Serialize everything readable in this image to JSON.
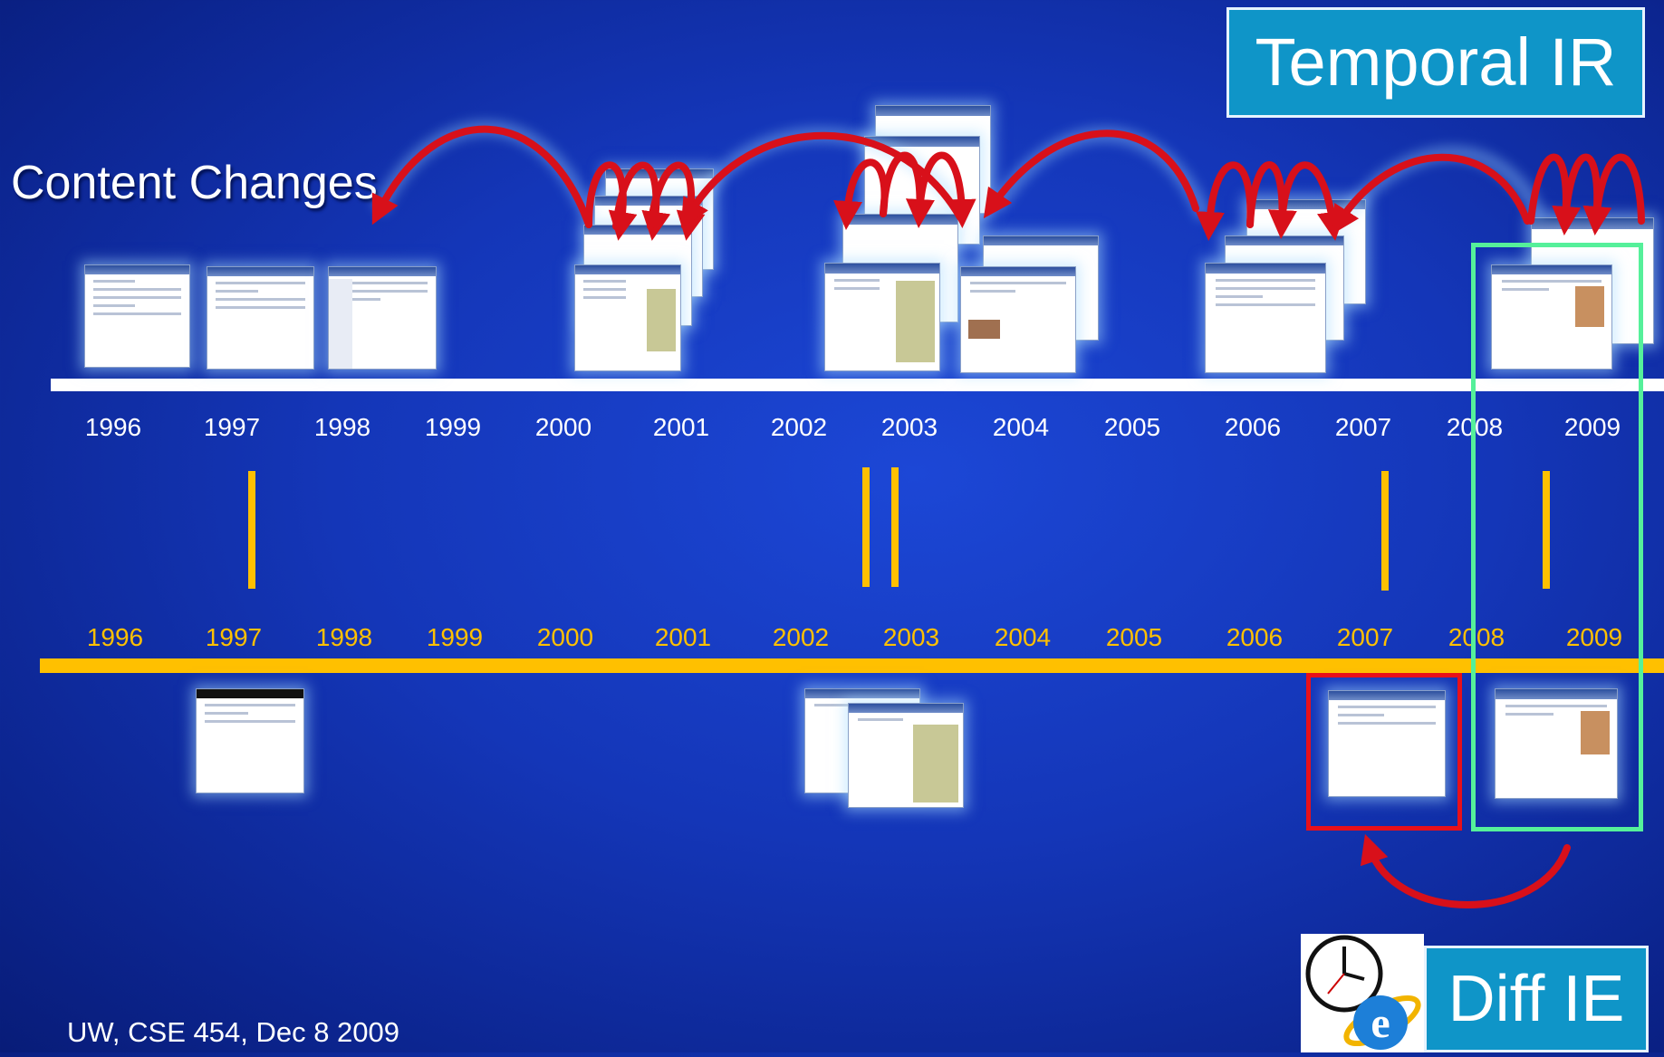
{
  "title": "Temporal IR",
  "section_label": "Content Changes",
  "footer": "UW, CSE 454, Dec 8 2009",
  "logo_label": "Diff IE",
  "timeline_top": {
    "years": [
      "1996",
      "1997",
      "1998",
      "1999",
      "2000",
      "2001",
      "2002",
      "2003",
      "2004",
      "2005",
      "2006",
      "2007",
      "2008",
      "2009"
    ]
  },
  "timeline_bottom": {
    "years": [
      "1996",
      "1997",
      "1998",
      "1999",
      "2000",
      "2001",
      "2002",
      "2003",
      "2004",
      "2005",
      "2006",
      "2007",
      "2008",
      "2009"
    ]
  },
  "colors": {
    "background": "#1436b8",
    "title_box": "#0f95c8",
    "arrow": "#d8101a",
    "gold": "#ffc000",
    "highlight_red": "#e8101a",
    "highlight_green": "#55f09a"
  },
  "icons": [
    "clock-icon",
    "internet-explorer-logo-icon"
  ]
}
